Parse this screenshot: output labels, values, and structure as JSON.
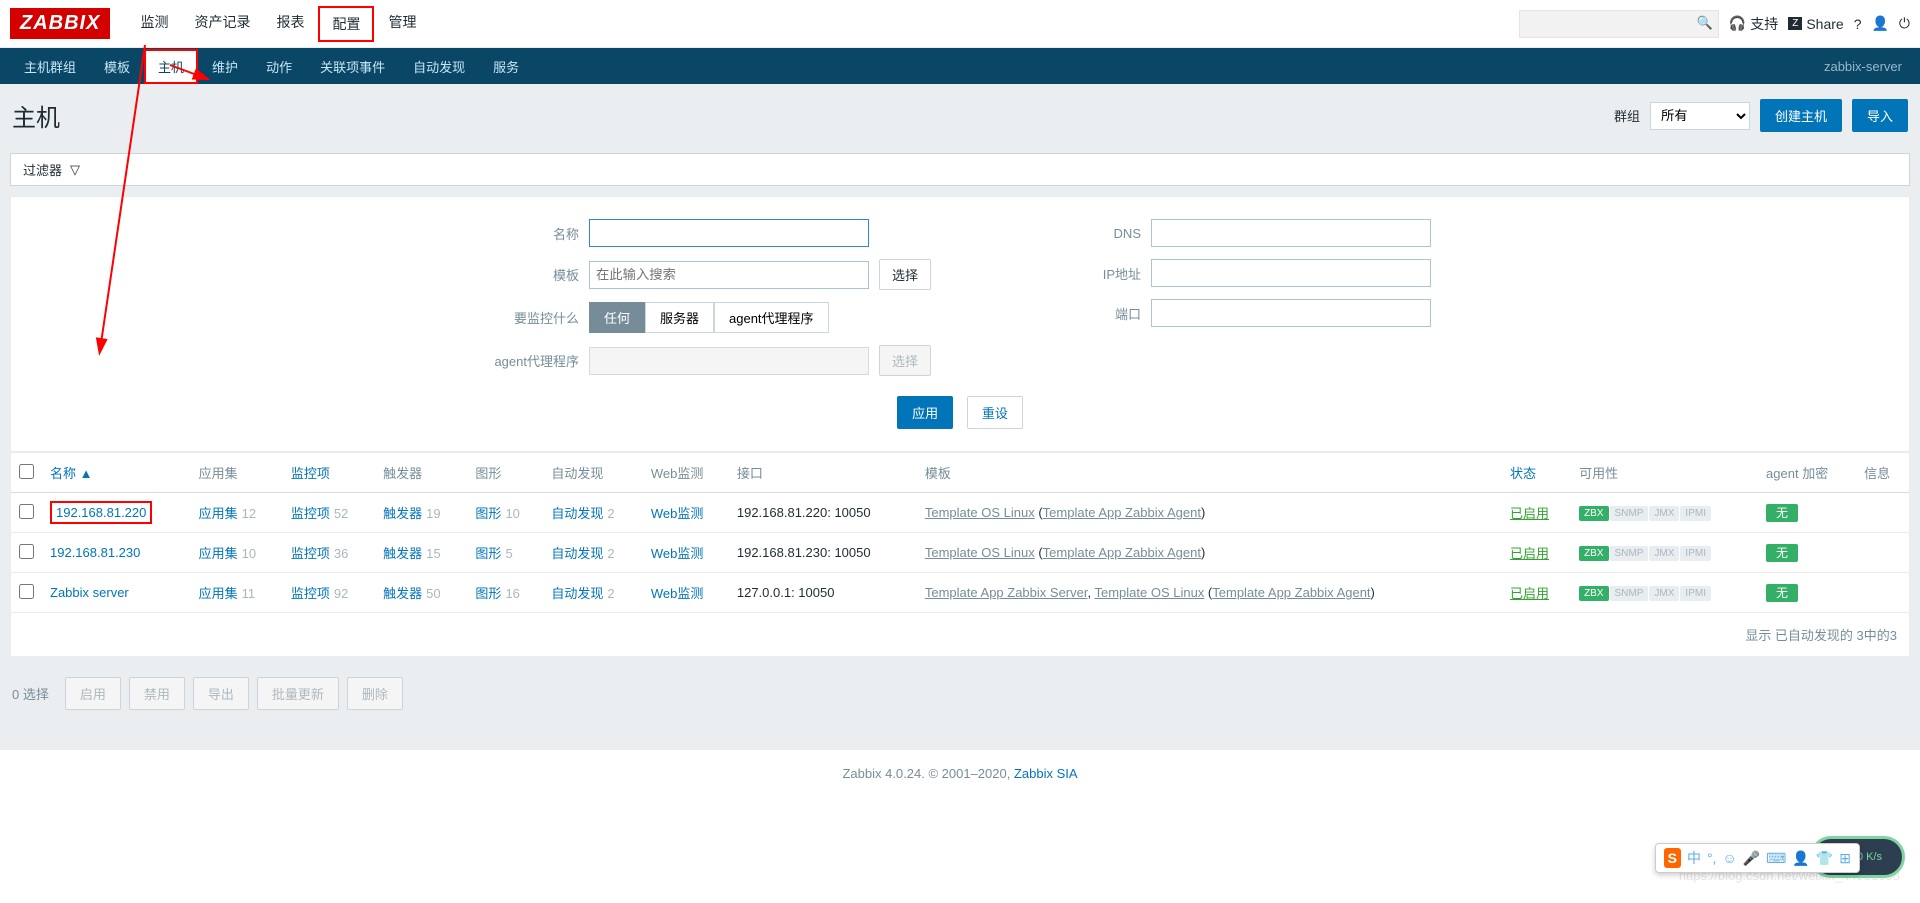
{
  "logo": "ZABBIX",
  "topnav": [
    "监测",
    "资产记录",
    "报表",
    "配置",
    "管理"
  ],
  "topnav_highlight_index": 3,
  "top_right": {
    "support": "支持",
    "share": "Share"
  },
  "subnav": [
    "主机群组",
    "模板",
    "主机",
    "维护",
    "动作",
    "关联项事件",
    "自动发现",
    "服务"
  ],
  "subnav_active_index": 2,
  "subnav_right": "zabbix-server",
  "page_title": "主机",
  "group_label": "群组",
  "group_value": "所有",
  "create_host_btn": "创建主机",
  "import_btn": "导入",
  "filter_toggle": "过滤器",
  "filter": {
    "name_label": "名称",
    "template_label": "模板",
    "template_placeholder": "在此输入搜索",
    "template_select_btn": "选择",
    "monitor_label": "要监控什么",
    "monitor_options": [
      "任何",
      "服务器",
      "agent代理程序"
    ],
    "agent_label": "agent代理程序",
    "agent_select_btn": "选择",
    "dns_label": "DNS",
    "ip_label": "IP地址",
    "port_label": "端口",
    "apply_btn": "应用",
    "reset_btn": "重设"
  },
  "columns": {
    "name": "名称",
    "apps": "应用集",
    "items": "监控项",
    "triggers": "触发器",
    "graphs": "图形",
    "discovery": "自动发现",
    "web": "Web监测",
    "interface": "接口",
    "templates": "模板",
    "status": "状态",
    "availability": "可用性",
    "encryption": "agent 加密",
    "info": "信息"
  },
  "rows": [
    {
      "name": "192.168.81.220",
      "highlight": true,
      "apps": "12",
      "items": "52",
      "triggers": "19",
      "graphs": "10",
      "discovery": "2",
      "interface": "192.168.81.220: 10050",
      "templates": "Template OS Linux",
      "templates_sub": "Template App Zabbix Agent",
      "status": "已启用",
      "encrypt": "无"
    },
    {
      "name": "192.168.81.230",
      "highlight": false,
      "apps": "10",
      "items": "36",
      "triggers": "15",
      "graphs": "5",
      "discovery": "2",
      "interface": "192.168.81.230: 10050",
      "templates": "Template OS Linux",
      "templates_sub": "Template App Zabbix Agent",
      "status": "已启用",
      "encrypt": "无"
    },
    {
      "name": "Zabbix server",
      "highlight": false,
      "apps": "11",
      "items": "92",
      "triggers": "50",
      "graphs": "16",
      "discovery": "2",
      "interface": "127.0.0.1: 10050",
      "templates_multi": [
        "Template App Zabbix Server",
        ", ",
        "Template OS Linux"
      ],
      "templates_sub": "Template App Zabbix Agent",
      "status": "已启用",
      "encrypt": "无"
    }
  ],
  "link_labels": {
    "apps": "应用集",
    "items": "监控项",
    "triggers": "触发器",
    "graphs": "图形",
    "discovery": "自动发现",
    "web": "Web监测"
  },
  "badges": [
    "ZBX",
    "SNMP",
    "JMX",
    "IPMI"
  ],
  "table_footer": "显示 已自动发现的 3中的3",
  "bulk": {
    "selected": "0 选择",
    "enable": "启用",
    "disable": "禁用",
    "export": "导出",
    "massupdate": "批量更新",
    "delete": "删除"
  },
  "footer": {
    "text": "Zabbix 4.0.24. © 2001–2020, ",
    "link": "Zabbix SIA"
  },
  "watermark": "https://blog.csdn.net/weixin_44953658",
  "ime_char": "中",
  "speed": "410 K/s"
}
